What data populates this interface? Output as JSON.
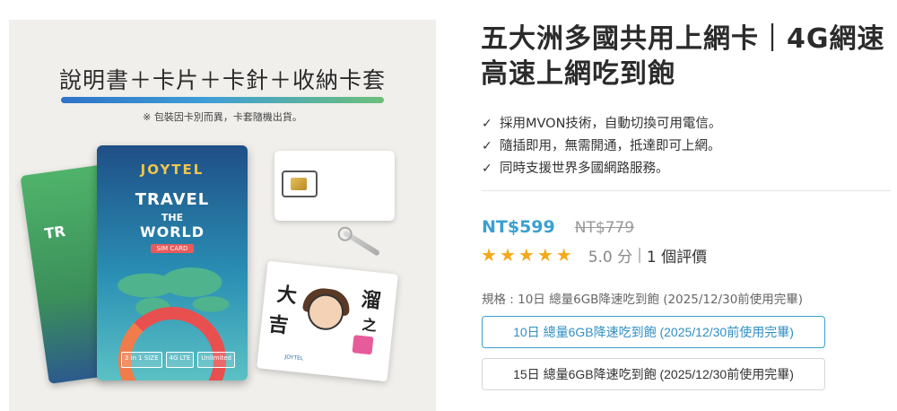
{
  "image": {
    "heading": "說明書＋卡片＋卡針＋收納卡套",
    "note": "※ 包裝因卡別而異，卡套隨機出貨。",
    "card_brand": "JOYTEL",
    "card_title_1": "TRAVEL",
    "card_title_2": "THE",
    "card_title_3": "WORLD",
    "card_sim_tag": "SIM CARD",
    "card_spec_1": "3 in 1 SIZE",
    "card_spec_2": "4G LTE",
    "card_spec_3": "Unlimited",
    "green_card_text": "TR",
    "sleeve_char_1": "大",
    "sleeve_char_2": "吉",
    "sleeve_char_3": "溜",
    "sleeve_char_4": "之",
    "sleeve_footer": "JOYTEL"
  },
  "product": {
    "title": "五大洲多國共用上網卡｜4G網速高速上網吃到飽",
    "features": [
      "採用MVON技術，自動切換可用電信。",
      "隨插即用，無需開通，抵達即可上網。",
      "同時支援世界多國網路服務。"
    ],
    "check_glyph": "✓",
    "price_now": "NT$599",
    "price_old": "NT$779",
    "rating": {
      "stars": 5,
      "star_glyph": "★",
      "score": "5.0 分",
      "separator": "|",
      "reviews": "1 個評價"
    },
    "spec_label": "規格 : 10日 總量6GB降速吃到飽 (2025/12/30前使用完畢)",
    "options": [
      {
        "label": "10日 總量6GB降速吃到飽 (2025/12/30前使用完畢)",
        "selected": true
      },
      {
        "label": "15日 總量6GB降速吃到飽 (2025/12/30前使用完畢)",
        "selected": false
      }
    ]
  },
  "colors": {
    "accent": "#3aa0cf",
    "star": "#f4a91c",
    "old_price": "#999999"
  }
}
